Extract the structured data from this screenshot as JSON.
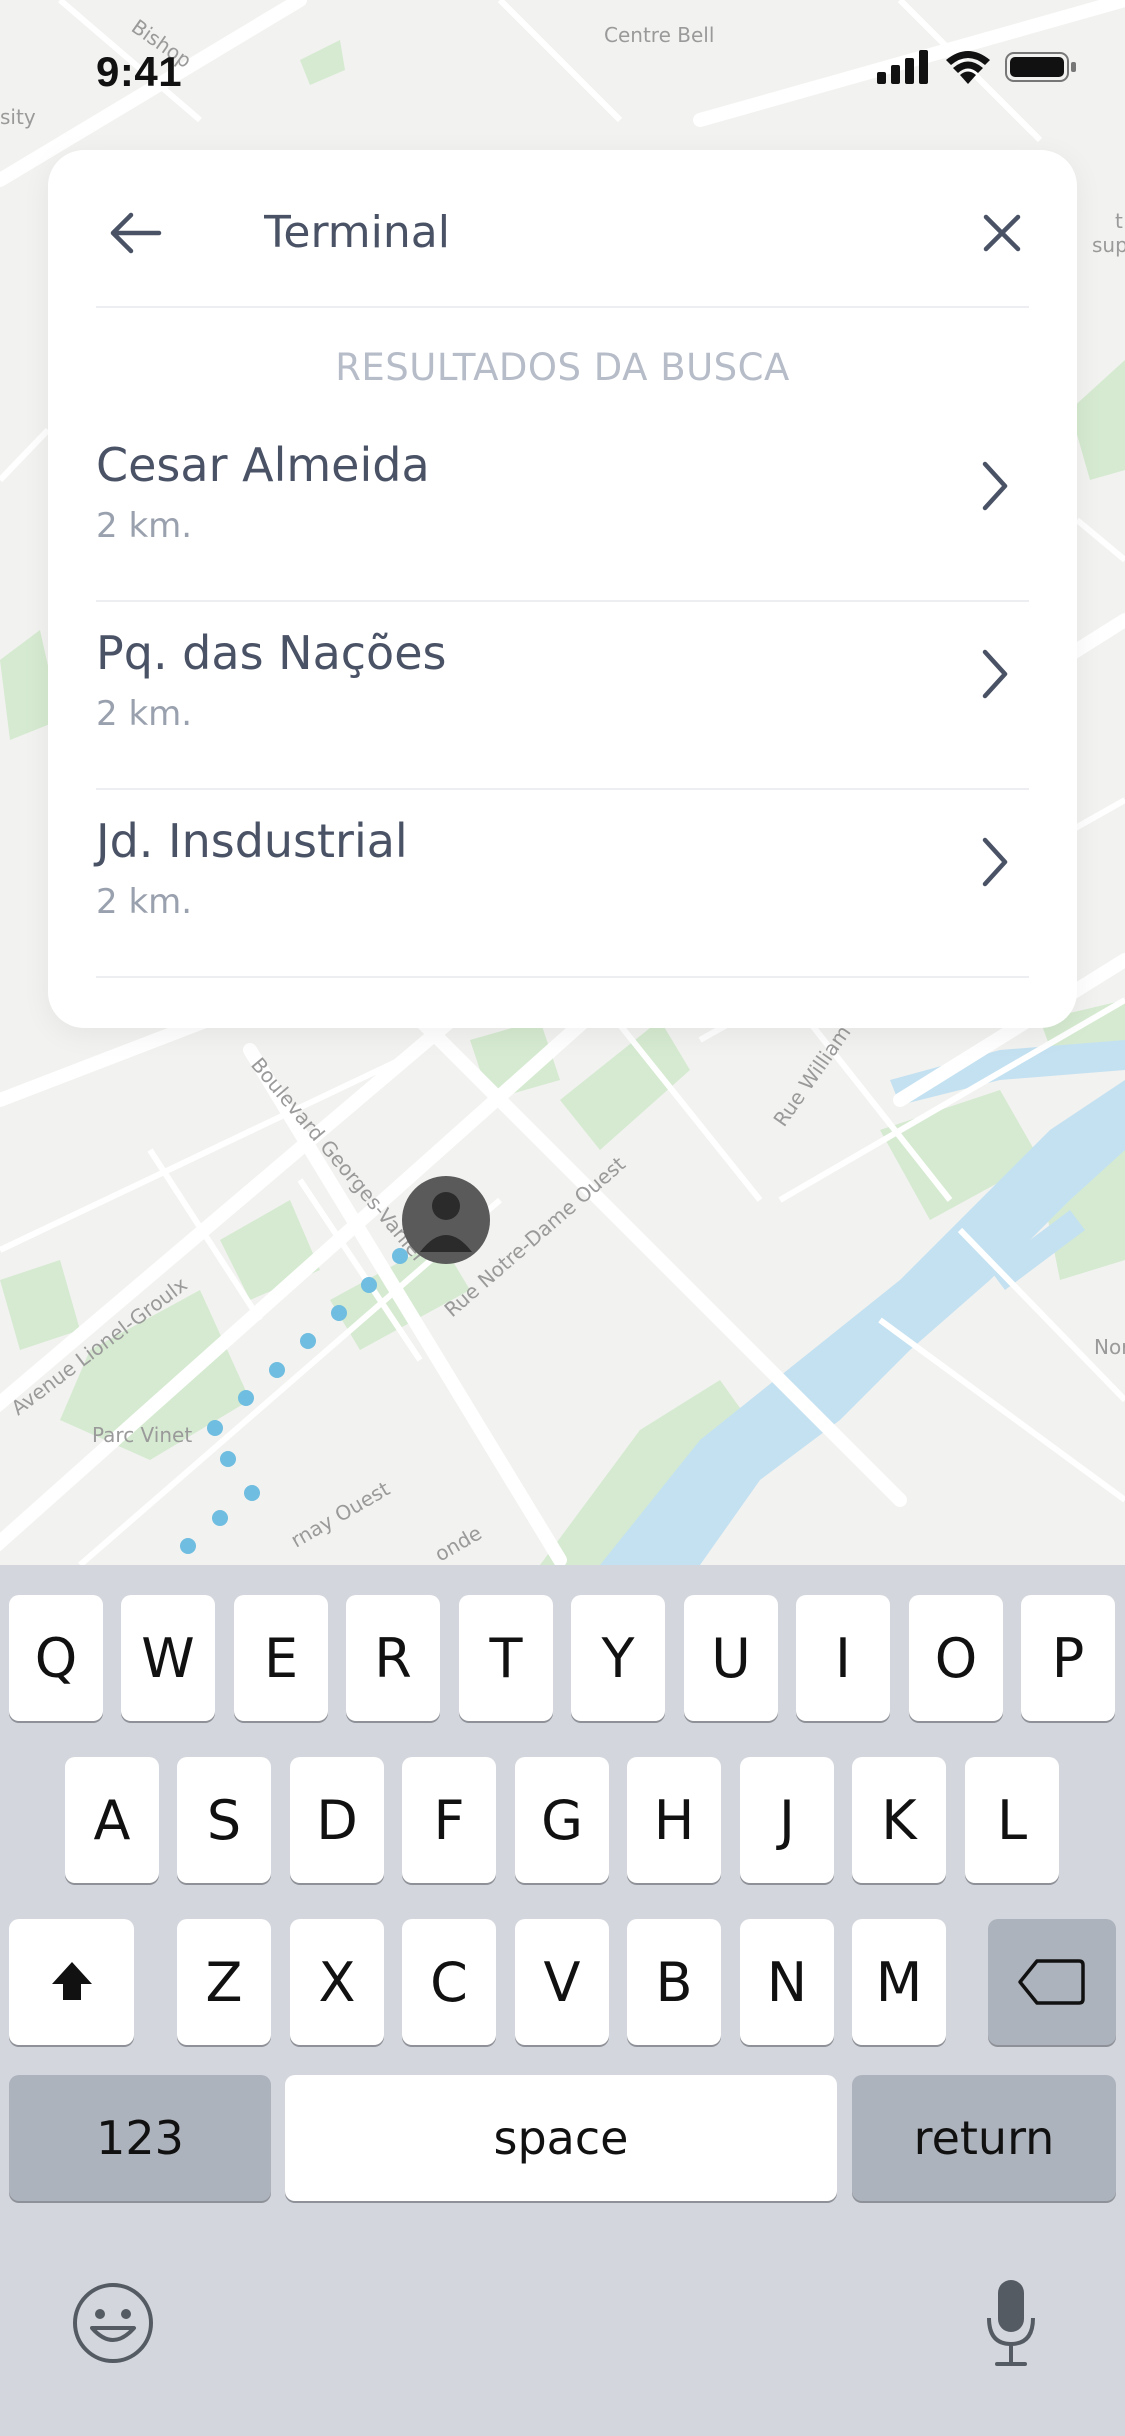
{
  "status_bar": {
    "time": "9:41",
    "icons": [
      "cellular-signal-icon",
      "wifi-icon",
      "battery-icon"
    ]
  },
  "map": {
    "labels": [
      "Centre Bell",
      "Bishop",
      "sity",
      "Boulevard Georges-Vanier",
      "Rue Notre-Dame Ouest",
      "Rue William",
      "Avenue Lionel-Groulx",
      "Parc Vinet",
      "rnay Ouest",
      "onde",
      "Nor",
      "t",
      "sup"
    ],
    "colors": {
      "background": "#f2f2f0",
      "water": "#c4e1f1",
      "park": "#d5ead0",
      "route": "#6fbde0"
    }
  },
  "search": {
    "value": "Terminal",
    "back_icon": "arrow-left-icon",
    "clear_icon": "close-icon",
    "section_title": "RESULTADOS DA BUSCA",
    "results": [
      {
        "name": "Cesar Almeida",
        "distance": "2 km."
      },
      {
        "name": "Pq. das Nações",
        "distance": "2 km."
      },
      {
        "name": "Jd. Insdustrial",
        "distance": "2 km."
      }
    ]
  },
  "keyboard": {
    "row1": [
      "Q",
      "W",
      "E",
      "R",
      "T",
      "Y",
      "U",
      "I",
      "O",
      "P"
    ],
    "row2": [
      "A",
      "S",
      "D",
      "F",
      "G",
      "H",
      "J",
      "K",
      "L"
    ],
    "row3": [
      "Z",
      "X",
      "C",
      "V",
      "B",
      "N",
      "M"
    ],
    "numbers_key": "123",
    "space_key": "space",
    "return_key": "return",
    "shift_icon": "shift-icon",
    "delete_icon": "backspace-icon",
    "emoji_icon": "emoji-icon",
    "mic_icon": "microphone-icon"
  }
}
